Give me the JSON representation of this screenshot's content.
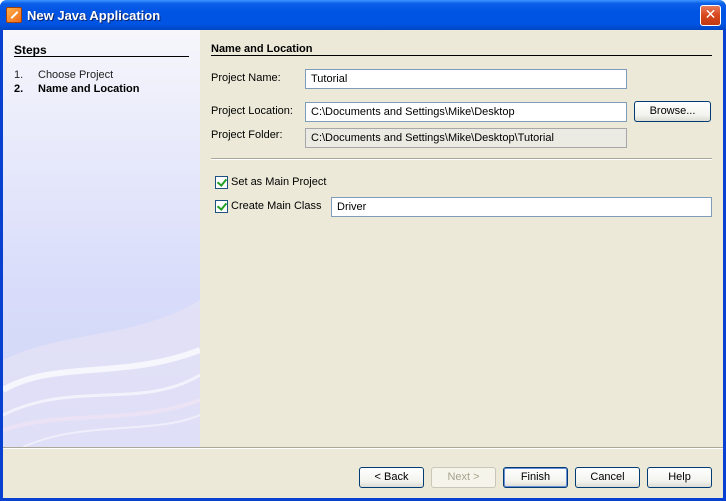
{
  "window": {
    "title": "New Java Application",
    "close_glyph": "✕"
  },
  "steps": {
    "title": "Steps",
    "items": [
      {
        "num": "1.",
        "label": "Choose Project"
      },
      {
        "num": "2.",
        "label": "Name and Location"
      }
    ]
  },
  "panel": {
    "title": "Name and Location",
    "project_name_label": "Project Name:",
    "project_name_value": "Tutorial",
    "project_location_label": "Project Location:",
    "project_location_value": "C:\\Documents and Settings\\Mike\\Desktop",
    "browse_label": "Browse...",
    "project_folder_label": "Project Folder:",
    "project_folder_value": "C:\\Documents and Settings\\Mike\\Desktop\\Tutorial",
    "set_main_label": "Set as Main Project",
    "create_main_label": "Create Main Class",
    "main_class_value": "Driver"
  },
  "buttons": {
    "back": "< Back",
    "next": "Next >",
    "finish": "Finish",
    "cancel": "Cancel",
    "help": "Help"
  }
}
